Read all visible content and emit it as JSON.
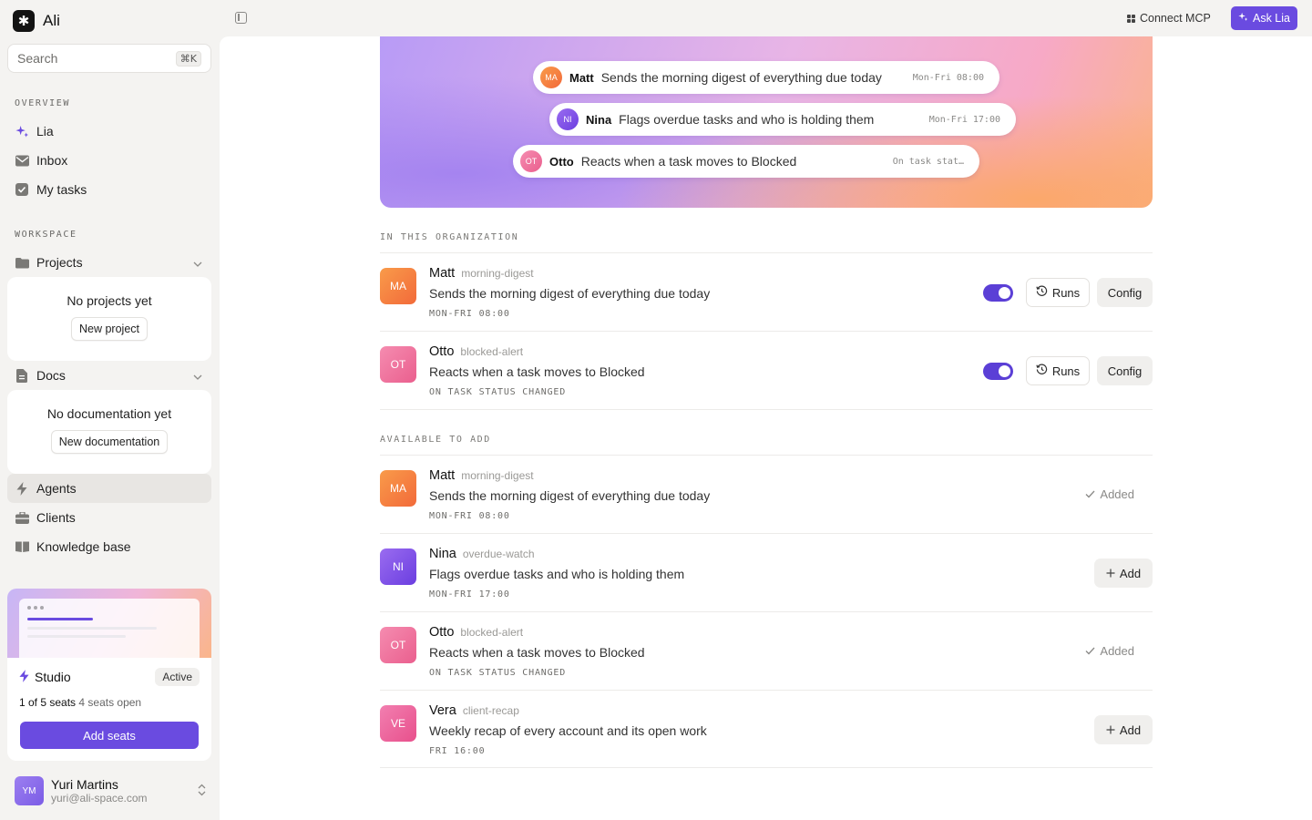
{
  "app": {
    "name": "Ali",
    "logo_glyph": "✱"
  },
  "search": {
    "placeholder": "Search",
    "shortcut": "⌘K"
  },
  "sidebar": {
    "overview_label": "OVERVIEW",
    "overview_items": [
      {
        "label": "Lia",
        "icon": "sparkle-icon"
      },
      {
        "label": "Inbox",
        "icon": "mail-icon"
      },
      {
        "label": "My tasks",
        "icon": "checkbox-icon"
      }
    ],
    "workspace_label": "WORKSPACE",
    "projects": {
      "label": "Projects",
      "empty_text": "No projects yet",
      "button": "New project"
    },
    "docs": {
      "label": "Docs",
      "empty_text": "No documentation yet",
      "button": "New documentation"
    },
    "workspace_items": [
      {
        "label": "Agents",
        "icon": "bolt-icon",
        "active": true
      },
      {
        "label": "Clients",
        "icon": "briefcase-icon"
      },
      {
        "label": "Knowledge base",
        "icon": "book-icon"
      }
    ],
    "plan": {
      "name": "Studio",
      "status": "Active",
      "seats_used": "1 of 5 seats",
      "seats_open": "4 seats open",
      "button": "Add seats"
    },
    "user": {
      "initials": "YM",
      "name": "Yuri Martins",
      "email": "yuri@ali-space.com"
    }
  },
  "topbar": {
    "connect_label": "Connect MCP",
    "ask_label": "Ask Lia"
  },
  "hero_pills": [
    {
      "initials": "MA",
      "name": "Matt",
      "desc": "Sends the morning digest of everything due today",
      "sched": "Mon-Fri 08:00"
    },
    {
      "initials": "NI",
      "name": "Nina",
      "desc": "Flags overdue tasks and who is holding them",
      "sched": "Mon-Fri 17:00"
    },
    {
      "initials": "OT",
      "name": "Otto",
      "desc": "Reacts when a task moves to Blocked",
      "sched": "On task stat…"
    }
  ],
  "org": {
    "label": "IN THIS ORGANIZATION",
    "runs_label": "Runs",
    "config_label": "Config",
    "rows": [
      {
        "initials": "MA",
        "name": "Matt",
        "slug": "morning-digest",
        "desc": "Sends the morning digest of everything due today",
        "sched": "MON-FRI 08:00",
        "enabled": true
      },
      {
        "initials": "OT",
        "name": "Otto",
        "slug": "blocked-alert",
        "desc": "Reacts when a task moves to Blocked",
        "sched": "ON TASK STATUS CHANGED",
        "enabled": true
      }
    ]
  },
  "available": {
    "label": "AVAILABLE TO ADD",
    "added_label": "Added",
    "add_label": "Add",
    "rows": [
      {
        "initials": "MA",
        "name": "Matt",
        "slug": "morning-digest",
        "desc": "Sends the morning digest of everything due today",
        "sched": "MON-FRI 08:00",
        "added": true
      },
      {
        "initials": "NI",
        "name": "Nina",
        "slug": "overdue-watch",
        "desc": "Flags overdue tasks and who is holding them",
        "sched": "MON-FRI 17:00",
        "added": false
      },
      {
        "initials": "OT",
        "name": "Otto",
        "slug": "blocked-alert",
        "desc": "Reacts when a task moves to Blocked",
        "sched": "ON TASK STATUS CHANGED",
        "added": true
      },
      {
        "initials": "VE",
        "name": "Vera",
        "slug": "client-recap",
        "desc": "Weekly recap of every account and its open work",
        "sched": "FRI 16:00",
        "added": false
      }
    ]
  },
  "colors": {
    "accent": "#6a4be0",
    "matt": "#f7763a",
    "nina": "#7b4fe6",
    "otto": "#ef6b96",
    "vera": "#ec5c98"
  }
}
